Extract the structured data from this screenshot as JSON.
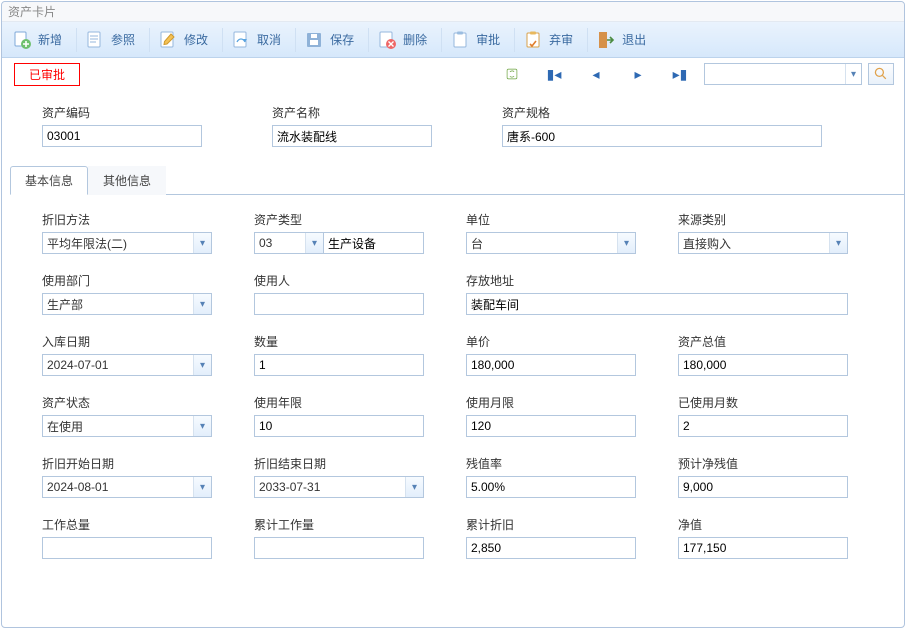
{
  "window": {
    "title": "资产卡片"
  },
  "toolbar": {
    "new": "新增",
    "refer": "参照",
    "edit": "修改",
    "cancel": "取消",
    "save": "保存",
    "delete": "删除",
    "approve": "审批",
    "unapprove": "弃审",
    "exit": "退出"
  },
  "status": {
    "label": "已审批"
  },
  "nav": {
    "search_placeholder": ""
  },
  "header": {
    "code_label": "资产编码",
    "code": "03001",
    "name_label": "资产名称",
    "name": "流水装配线",
    "spec_label": "资产规格",
    "spec": "唐系-600"
  },
  "tabs": {
    "basic": "基本信息",
    "other": "其他信息"
  },
  "form": {
    "depreciation_method": {
      "label": "折旧方法",
      "value": "平均年限法(二)"
    },
    "asset_type": {
      "label": "资产类型",
      "code": "03",
      "text": "生产设备"
    },
    "unit": {
      "label": "单位",
      "value": "台"
    },
    "source": {
      "label": "来源类别",
      "value": "直接购入"
    },
    "dept": {
      "label": "使用部门",
      "value": "生产部"
    },
    "user": {
      "label": "使用人",
      "value": ""
    },
    "location": {
      "label": "存放地址",
      "value": "装配车间"
    },
    "in_date": {
      "label": "入库日期",
      "value": "2024-07-01"
    },
    "qty": {
      "label": "数量",
      "value": "1"
    },
    "price": {
      "label": "单价",
      "value": "180,000"
    },
    "total": {
      "label": "资产总值",
      "value": "180,000"
    },
    "status": {
      "label": "资产状态",
      "value": "在使用"
    },
    "years": {
      "label": "使用年限",
      "value": "10"
    },
    "months": {
      "label": "使用月限",
      "value": "120"
    },
    "used_months": {
      "label": "已使用月数",
      "value": "2"
    },
    "dep_start": {
      "label": "折旧开始日期",
      "value": "2024-08-01"
    },
    "dep_end": {
      "label": "折旧结束日期",
      "value": "2033-07-31"
    },
    "salvage_rate": {
      "label": "残值率",
      "value": "5.00%"
    },
    "net_salvage": {
      "label": "预计净残值",
      "value": "9,000"
    },
    "work_total": {
      "label": "工作总量",
      "value": ""
    },
    "work_accum": {
      "label": "累计工作量",
      "value": ""
    },
    "dep_accum": {
      "label": "累计折旧",
      "value": "2,850"
    },
    "net_value": {
      "label": "净值",
      "value": "177,150"
    }
  }
}
